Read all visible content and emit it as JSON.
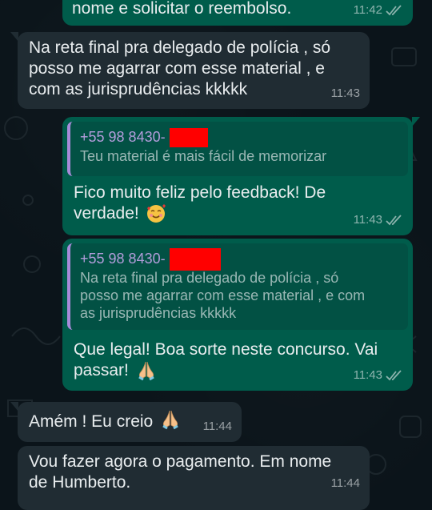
{
  "messages": [
    {
      "direction": "out",
      "text": "nome e solicitar o reembolso.",
      "time": "11:42",
      "status": "read-ticks-icon"
    },
    {
      "direction": "in",
      "text": "Na reta final pra delegado de polícia , só\nposso me agarrar com esse material , e\ncom as jurisprudências kkkkk",
      "time": "11:43"
    },
    {
      "direction": "out",
      "quote": {
        "sender": "+55 98 8430-",
        "text": "Teu material é mais fácil de memorizar"
      },
      "text": "Fico muito feliz pelo feedback! De\nverdade!",
      "emoji": "smiling-face-with-hearts-icon",
      "time": "11:43",
      "status": "read-ticks-icon"
    },
    {
      "direction": "out",
      "quote": {
        "sender": "+55 98 8430-",
        "text": "Na reta final pra delegado de polícia , só\nposso me agarrar com esse material , e com\nas jurisprudências kkkkk"
      },
      "text": "Que legal! Boa sorte neste concurso. Vai\npassar!",
      "emoji": "folded-hands-icon",
      "time": "11:43",
      "status": "read-ticks-icon"
    },
    {
      "direction": "in",
      "text": "Amém ! Eu creio",
      "emoji": "folded-hands-icon",
      "time": "11:44"
    },
    {
      "direction": "in",
      "text": "Vou fazer agora o pagamento. Em nome\nde Humberto.",
      "time": "11:44"
    }
  ],
  "colors": {
    "incoming": "#202c33",
    "outgoing": "#005c4b",
    "quote_bar": "#a78bd9",
    "redaction": "#ff0000",
    "background": "#0b141a"
  }
}
